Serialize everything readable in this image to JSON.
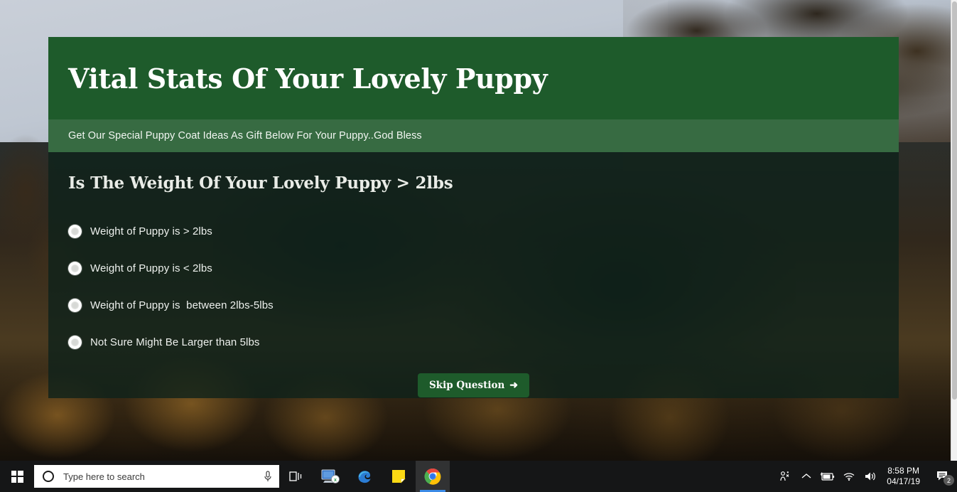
{
  "quiz": {
    "title": "Vital Stats Of Your Lovely Puppy",
    "subtitle": "Get Our Special Puppy Coat Ideas As Gift Below For Your Puppy..God Bless",
    "question": "Is The Weight Of Your Lovely Puppy > 2lbs",
    "options": [
      {
        "label": "Weight of Puppy is > 2lbs"
      },
      {
        "label": "Weight of Puppy is < 2lbs"
      },
      {
        "label": "Weight of Puppy is  between 2lbs-5lbs"
      },
      {
        "label": "Not Sure Might Be Larger than 5lbs"
      }
    ],
    "skip_label": "Skip Question",
    "skip_arrow": "➜",
    "colors": {
      "header_green": "#1e5b2b",
      "subbar_green": "#376b42",
      "body_overlay": "#0e221a",
      "button_green": "#1e5b2b"
    }
  },
  "taskbar": {
    "start": "start-button",
    "search_placeholder": "Type here to search",
    "icons": [
      {
        "name": "task-view-icon"
      },
      {
        "name": "remote-desktop-icon"
      },
      {
        "name": "edge-browser-icon"
      },
      {
        "name": "sticky-notes-icon"
      },
      {
        "name": "chrome-browser-icon"
      }
    ],
    "tray": [
      {
        "name": "meet-now-icon"
      },
      {
        "name": "show-hidden-icons-chevron"
      },
      {
        "name": "battery-charging-icon"
      },
      {
        "name": "wifi-icon"
      },
      {
        "name": "volume-icon"
      }
    ],
    "time": "8:58 PM",
    "date": "04/17/19",
    "notification_count": "2"
  }
}
